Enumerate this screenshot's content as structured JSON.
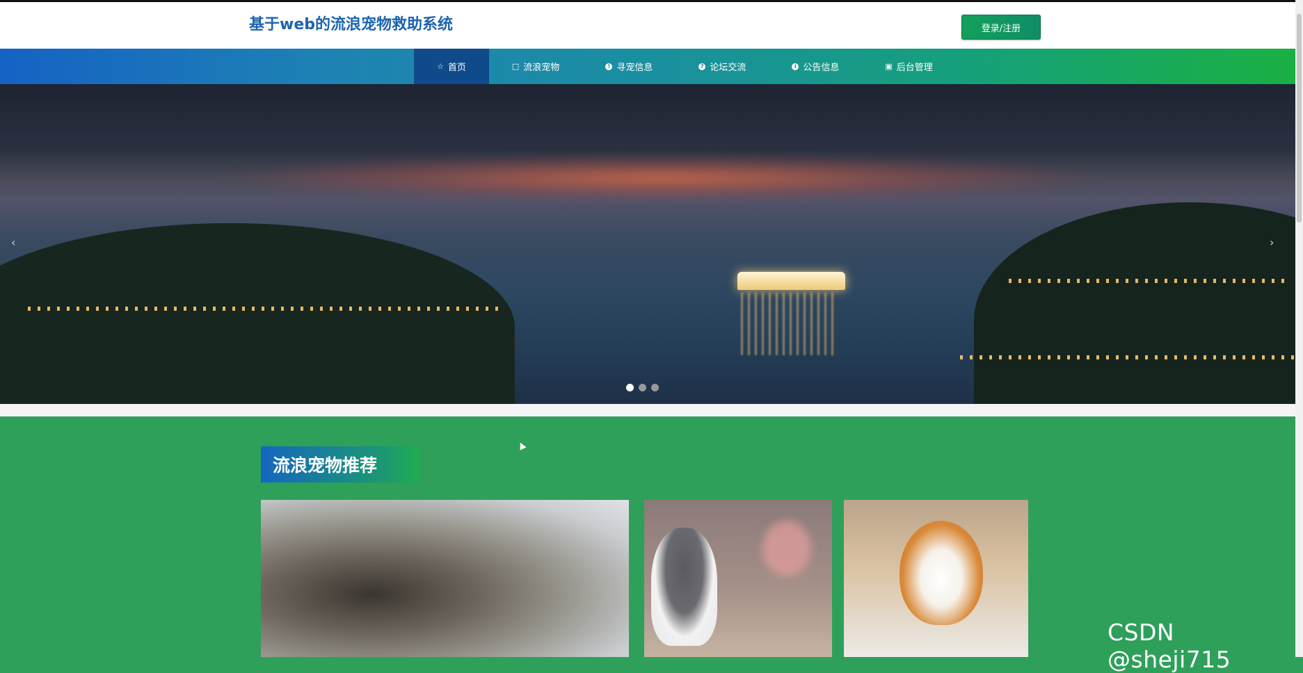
{
  "header": {
    "site_title": "基于web的流浪宠物救助系统",
    "login_label": "登录/注册"
  },
  "nav": {
    "items": [
      {
        "label": "首页",
        "icon": "star-icon",
        "active": true
      },
      {
        "label": "流浪宠物",
        "icon": "bag-icon",
        "active": false
      },
      {
        "label": "寻宠信息",
        "icon": "exclamation-circle-icon",
        "active": false
      },
      {
        "label": "论坛交流",
        "icon": "question-circle-icon",
        "active": false
      },
      {
        "label": "公告信息",
        "icon": "info-circle-icon",
        "active": false
      },
      {
        "label": "后台管理",
        "icon": "calendar-icon",
        "active": false
      }
    ]
  },
  "banner": {
    "prev_glyph": "‹",
    "next_glyph": "›",
    "slide_count": 3,
    "active_slide": 1
  },
  "section": {
    "title": "流浪宠物推荐"
  },
  "cards": [
    {
      "image": "fluffy-dog-photo"
    },
    {
      "image": "gray-white-cat-photo"
    },
    {
      "image": "chihuahua-photo"
    }
  ],
  "watermark": "CSDN @sheji715",
  "colors": {
    "brand_blue": "#1c64b0",
    "nav_active": "#0f4a8a",
    "page_green": "#2ea05a",
    "login_green": "#12a05a"
  }
}
